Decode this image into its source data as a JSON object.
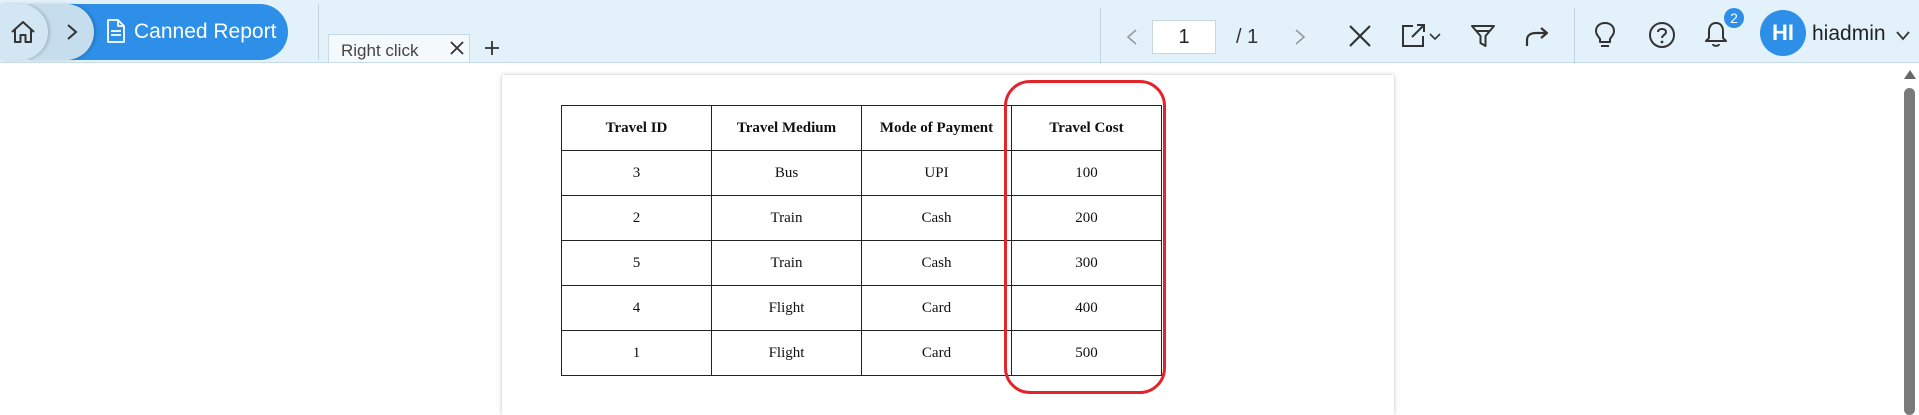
{
  "breadcrumb": {
    "current": "Canned Report"
  },
  "tabs": [
    {
      "label": "Right click",
      "active": true
    }
  ],
  "add_tab_label": "+",
  "pager": {
    "current_page": "1",
    "total": "/ 1"
  },
  "notifications": {
    "count": "2"
  },
  "user": {
    "initials": "HI",
    "name": "hiadmin"
  },
  "icons": [
    "home-icon",
    "chevron-right-icon",
    "document-icon",
    "close-icon",
    "plus-icon",
    "chevron-left-icon",
    "export-icon",
    "filter-icon",
    "share-icon",
    "lightbulb-icon",
    "help-icon",
    "bell-icon",
    "chevron-down-icon"
  ],
  "colors": {
    "accent": "#2d8fe8",
    "toolbar_bg": "#e3f1fa",
    "highlight": "#e3242b"
  },
  "report": {
    "headers": [
      "Travel ID",
      "Travel Medium",
      "Mode of Payment",
      "Travel Cost"
    ],
    "rows": [
      [
        "3",
        "Bus",
        "UPI",
        "100"
      ],
      [
        "2",
        "Train",
        "Cash",
        "200"
      ],
      [
        "5",
        "Train",
        "Cash",
        "300"
      ],
      [
        "4",
        "Flight",
        "Card",
        "400"
      ],
      [
        "1",
        "Flight",
        "Card",
        "500"
      ]
    ]
  }
}
